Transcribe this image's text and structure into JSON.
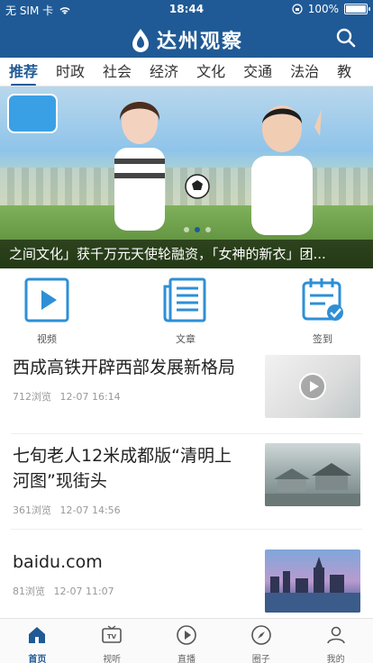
{
  "status": {
    "carrier": "无 SIM 卡",
    "time": "18:44",
    "battery": "100%"
  },
  "header": {
    "title": "达州观察"
  },
  "tabs": [
    {
      "label": "推荐",
      "active": true
    },
    {
      "label": "时政"
    },
    {
      "label": "社会"
    },
    {
      "label": "经济"
    },
    {
      "label": "文化"
    },
    {
      "label": "交通"
    },
    {
      "label": "法治"
    },
    {
      "label": "教"
    }
  ],
  "banner": {
    "caption": "之间文化」获千万元天使轮融资，「女神的新衣」团..."
  },
  "quick_actions": [
    {
      "label": "视频",
      "icon": "video-play-icon"
    },
    {
      "label": "文章",
      "icon": "article-icon"
    },
    {
      "label": "签到",
      "icon": "calendar-check-icon"
    }
  ],
  "news": [
    {
      "title": "西成高铁开辟西部发展新格局",
      "views": "712浏览",
      "date": "12-07 16:14",
      "has_video": true
    },
    {
      "title": "七旬老人12米成都版“清明上河图”现街头",
      "views": "361浏览",
      "date": "12-07 14:56"
    },
    {
      "title": "baidu.com",
      "views": "81浏览",
      "date": "12-07 11:07"
    }
  ],
  "bottom_nav": [
    {
      "label": "首页",
      "icon": "home-icon",
      "active": true
    },
    {
      "label": "视听",
      "icon": "tv-icon"
    },
    {
      "label": "直播",
      "icon": "live-play-icon"
    },
    {
      "label": "圈子",
      "icon": "compass-icon"
    },
    {
      "label": "我的",
      "icon": "user-icon"
    }
  ],
  "colors": {
    "brand": "#1f5a96"
  }
}
